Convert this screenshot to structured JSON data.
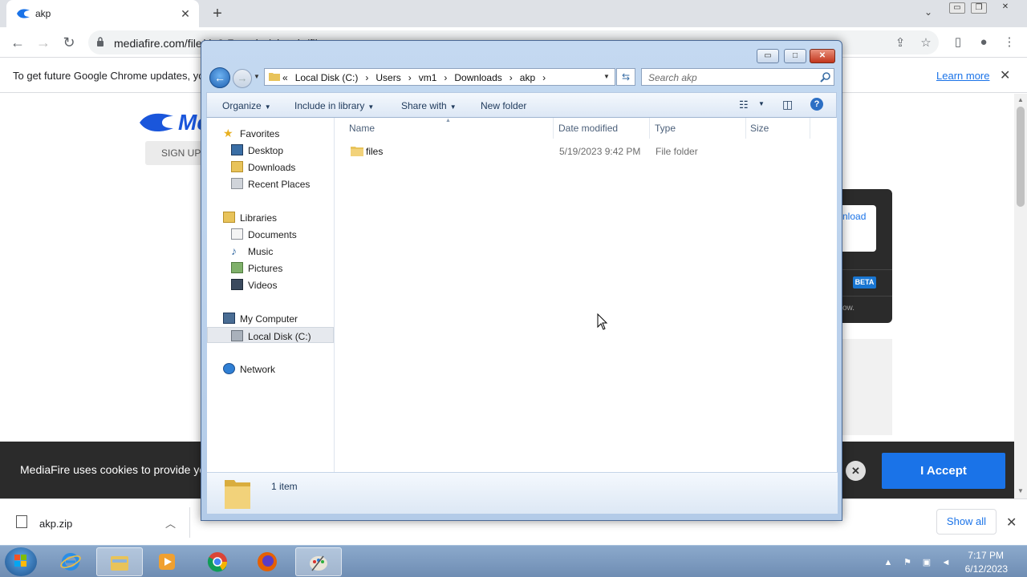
{
  "browser": {
    "tab_title": "akp",
    "url": "mediafire.com/file/do8r7a...akp/akp.zip/file",
    "infobar_text": "To get future Google Chrome updates, yo",
    "learn_more": "Learn more",
    "ctrl_minimize": "▭",
    "ctrl_restore": "❐",
    "ctrl_close": "✕"
  },
  "page": {
    "logo_text": "Mc",
    "signup": "SIGN UP",
    "download_text": "nload",
    "beta": "BETA",
    "panel_small": "ow.",
    "cookie_text": "MediaFire uses cookies to provide you",
    "accept": "I Accept"
  },
  "downloads": {
    "file_name": "akp.zip",
    "show_all": "Show all"
  },
  "taskbar": {
    "time": "7:17 PM",
    "date": "6/12/2023"
  },
  "explorer": {
    "breadcrumbs": [
      "«",
      "Local Disk (C:)",
      "›",
      "Users",
      "›",
      "vm1",
      "›",
      "Downloads",
      "›",
      "akp",
      "›"
    ],
    "search_placeholder": "Search akp",
    "commands": {
      "organize": "Organize",
      "include_in_library": "Include in library",
      "share_with": "Share with",
      "new_folder": "New folder"
    },
    "nav": {
      "favorites": "Favorites",
      "desktop": "Desktop",
      "downloads": "Downloads",
      "recent_places": "Recent Places",
      "libraries": "Libraries",
      "documents": "Documents",
      "music": "Music",
      "pictures": "Pictures",
      "videos": "Videos",
      "my_computer": "My Computer",
      "local_disk": "Local Disk (C:)",
      "network": "Network"
    },
    "columns": {
      "name": "Name",
      "date_modified": "Date modified",
      "type": "Type",
      "size": "Size"
    },
    "files": [
      {
        "name": "files",
        "date_modified": "5/19/2023 9:42 PM",
        "type": "File folder",
        "size": ""
      }
    ],
    "item_count": "1 item"
  },
  "colors": {
    "chrome_blue": "#1a73e8",
    "mediafire_blue": "#1a56db",
    "explorer_frame": "#c4d9f1"
  }
}
